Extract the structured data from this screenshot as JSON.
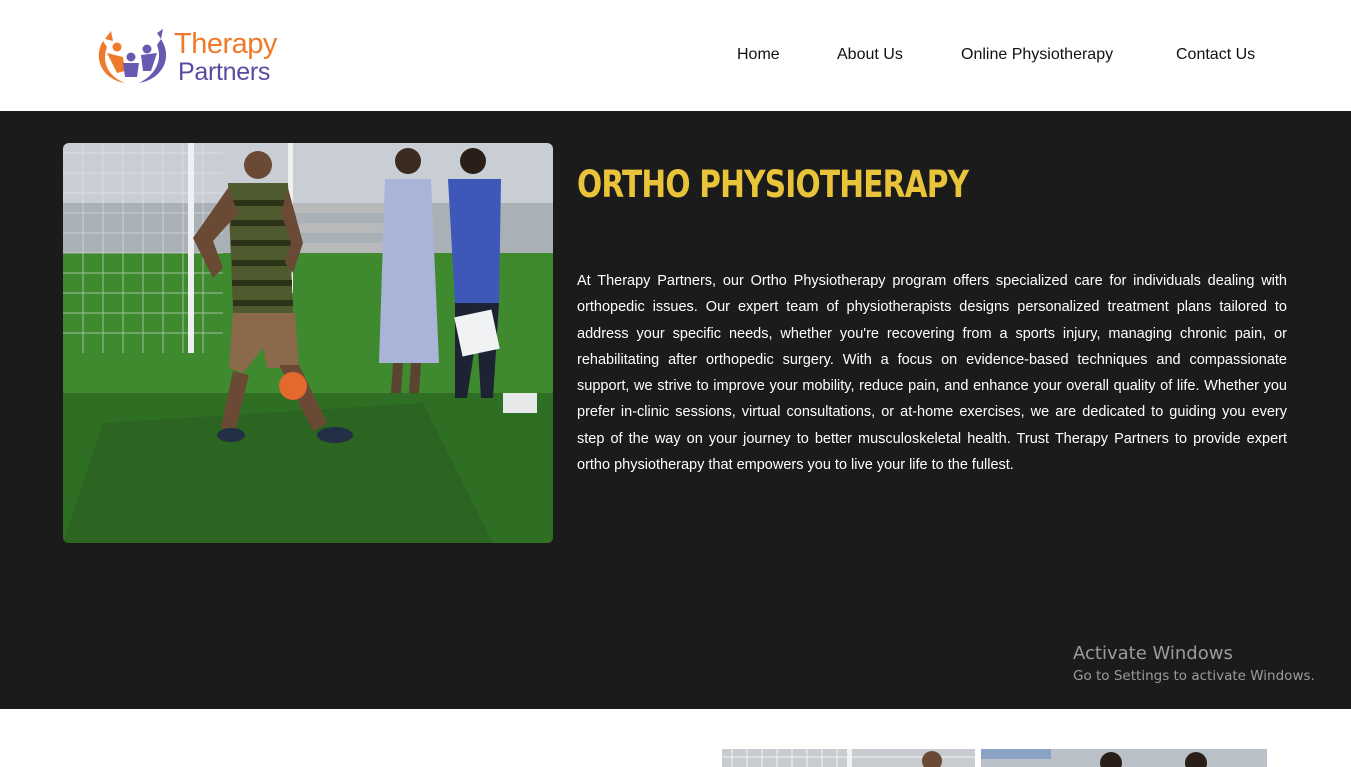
{
  "header": {
    "logo": {
      "line1": "Therapy",
      "line2": "Partners"
    },
    "nav": [
      {
        "label": "Home"
      },
      {
        "label": "About Us"
      },
      {
        "label": "Online Physiotherapy"
      },
      {
        "label": "Contact Us"
      }
    ]
  },
  "main": {
    "title": "ORTHO PHYSIOTHERAPY",
    "description": "At Therapy Partners, our Ortho Physiotherapy program offers specialized care for individuals dealing with orthopedic issues. Our expert team of physiotherapists designs personalized treatment plans tailored to address your specific needs, whether you're recovering from a sports injury, managing chronic pain, or rehabilitating after orthopedic surgery. With a focus on evidence-based techniques and compassionate support, we strive to improve your mobility, reduce pain, and enhance your overall quality of life. Whether you prefer in-clinic sessions, virtual consultations, or at-home exercises, we are dedicated to guiding you every step of the way on your journey to better musculoskeletal health. Trust Therapy Partners to provide expert ortho physiotherapy that empowers you to live your life to the fullest."
  },
  "watermark": {
    "title": "Activate Windows",
    "subtitle": "Go to Settings to activate Windows."
  },
  "colors": {
    "accent_title": "#e9c43a",
    "logo_orange": "#f07a2c",
    "logo_purple": "#5b4aa0",
    "section_bg": "#1b1b1b"
  }
}
